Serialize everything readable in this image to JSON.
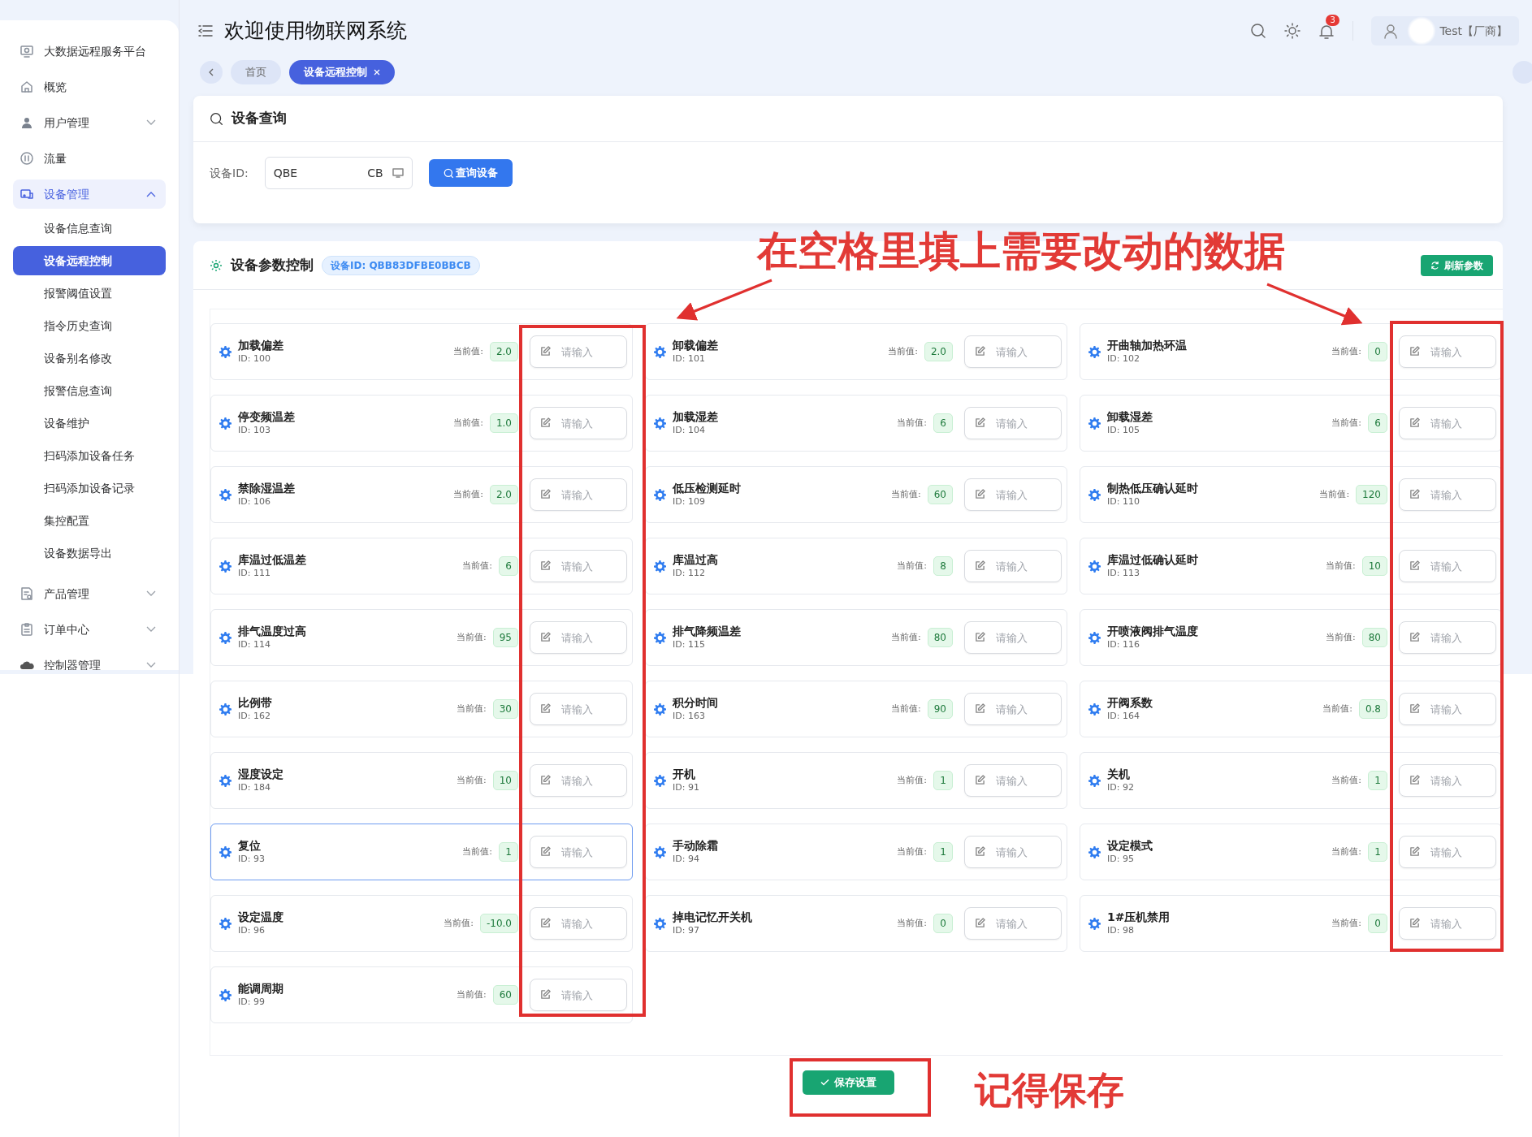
{
  "sidebar": {
    "items": [
      {
        "label": "大数据远程服务平台",
        "selected": false
      },
      {
        "label": "概览",
        "selected": false
      },
      {
        "label": "用户管理",
        "selected": false,
        "expanded": false
      },
      {
        "label": "流量",
        "selected": false
      },
      {
        "label": "设备管理",
        "selected": true,
        "expanded": true,
        "children": [
          {
            "label": "设备信息查询",
            "selected": false
          },
          {
            "label": "设备远程控制",
            "selected": true
          },
          {
            "label": "报警阈值设置",
            "selected": false
          },
          {
            "label": "指令历史查询",
            "selected": false
          },
          {
            "label": "设备别名修改",
            "selected": false
          },
          {
            "label": "报警信息查询",
            "selected": false
          },
          {
            "label": "设备维护",
            "selected": false
          },
          {
            "label": "扫码添加设备任务",
            "selected": false
          },
          {
            "label": "扫码添加设备记录",
            "selected": false
          },
          {
            "label": "集控配置",
            "selected": false
          },
          {
            "label": "设备数据导出",
            "selected": false
          }
        ]
      },
      {
        "label": "产品管理",
        "selected": false,
        "expanded": false
      },
      {
        "label": "订单中心",
        "selected": false,
        "expanded": false
      },
      {
        "label": "控制器管理",
        "selected": false,
        "expanded": false
      }
    ]
  },
  "header": {
    "title": "欢迎使用物联网系统",
    "notification_count": "3",
    "user": "Test【厂商】"
  },
  "tabs": [
    {
      "label": "首页",
      "selected": false,
      "closable": false
    },
    {
      "label": "设备远程控制",
      "selected": true,
      "closable": true
    }
  ],
  "query": {
    "title": "设备查询",
    "field_label": "设备ID:",
    "value_start": "QBE",
    "value_end": "CB",
    "button": "查询设备"
  },
  "params": {
    "title": "设备参数控制",
    "device_badge": "设备ID: QBB83DFBE0BBCB",
    "refresh_button": "刷新参数",
    "save_button": "保存设置",
    "parameters": [
      {
        "name": "加载偏差",
        "id": "ID: 100",
        "label": "当前值:",
        "value": "2.0",
        "placeholder": "请输入",
        "highlighted": false
      },
      {
        "name": "卸载偏差",
        "id": "ID: 101",
        "label": "当前值:",
        "value": "2.0",
        "placeholder": "请输入",
        "highlighted": false
      },
      {
        "name": "开曲轴加热环温",
        "id": "ID: 102",
        "label": "当前值:",
        "value": "0",
        "placeholder": "请输入",
        "highlighted": false
      },
      {
        "name": "停变频温差",
        "id": "ID: 103",
        "label": "当前值:",
        "value": "1.0",
        "placeholder": "请输入",
        "highlighted": false
      },
      {
        "name": "加载湿差",
        "id": "ID: 104",
        "label": "当前值:",
        "value": "6",
        "placeholder": "请输入",
        "highlighted": false
      },
      {
        "name": "卸载湿差",
        "id": "ID: 105",
        "label": "当前值:",
        "value": "6",
        "placeholder": "请输入",
        "highlighted": false
      },
      {
        "name": "禁除湿温差",
        "id": "ID: 106",
        "label": "当前值:",
        "value": "2.0",
        "placeholder": "请输入",
        "highlighted": false
      },
      {
        "name": "低压检测延时",
        "id": "ID: 109",
        "label": "当前值:",
        "value": "60",
        "placeholder": "请输入",
        "highlighted": false
      },
      {
        "name": "制热低压确认延时",
        "id": "ID: 110",
        "label": "当前值:",
        "value": "120",
        "placeholder": "请输入",
        "highlighted": false
      },
      {
        "name": "库温过低温差",
        "id": "ID: 111",
        "label": "当前值:",
        "value": "6",
        "placeholder": "请输入",
        "highlighted": false
      },
      {
        "name": "库温过高",
        "id": "ID: 112",
        "label": "当前值:",
        "value": "8",
        "placeholder": "请输入",
        "highlighted": false
      },
      {
        "name": "库温过低确认延时",
        "id": "ID: 113",
        "label": "当前值:",
        "value": "10",
        "placeholder": "请输入",
        "highlighted": false
      },
      {
        "name": "排气温度过高",
        "id": "ID: 114",
        "label": "当前值:",
        "value": "95",
        "placeholder": "请输入",
        "highlighted": false
      },
      {
        "name": "排气降频温差",
        "id": "ID: 115",
        "label": "当前值:",
        "value": "80",
        "placeholder": "请输入",
        "highlighted": false
      },
      {
        "name": "开喷液阀排气温度",
        "id": "ID: 116",
        "label": "当前值:",
        "value": "80",
        "placeholder": "请输入",
        "highlighted": false
      },
      {
        "name": "比例带",
        "id": "ID: 162",
        "label": "当前值:",
        "value": "30",
        "placeholder": "请输入",
        "highlighted": false
      },
      {
        "name": "积分时间",
        "id": "ID: 163",
        "label": "当前值:",
        "value": "90",
        "placeholder": "请输入",
        "highlighted": false
      },
      {
        "name": "开阀系数",
        "id": "ID: 164",
        "label": "当前值:",
        "value": "0.8",
        "placeholder": "请输入",
        "highlighted": false
      },
      {
        "name": "湿度设定",
        "id": "ID: 184",
        "label": "当前值:",
        "value": "10",
        "placeholder": "请输入",
        "highlighted": false
      },
      {
        "name": "开机",
        "id": "ID: 91",
        "label": "当前值:",
        "value": "1",
        "placeholder": "请输入",
        "highlighted": false
      },
      {
        "name": "关机",
        "id": "ID: 92",
        "label": "当前值:",
        "value": "1",
        "placeholder": "请输入",
        "highlighted": false
      },
      {
        "name": "复位",
        "id": "ID: 93",
        "label": "当前值:",
        "value": "1",
        "placeholder": "请输入",
        "highlighted": true
      },
      {
        "name": "手动除霜",
        "id": "ID: 94",
        "label": "当前值:",
        "value": "1",
        "placeholder": "请输入",
        "highlighted": false
      },
      {
        "name": "设定模式",
        "id": "ID: 95",
        "label": "当前值:",
        "value": "1",
        "placeholder": "请输入",
        "highlighted": false
      },
      {
        "name": "设定温度",
        "id": "ID: 96",
        "label": "当前值:",
        "value": "-10.0",
        "placeholder": "请输入",
        "highlighted": false
      },
      {
        "name": "掉电记忆开关机",
        "id": "ID: 97",
        "label": "当前值:",
        "value": "0",
        "placeholder": "请输入",
        "highlighted": false
      },
      {
        "name": "1#压机禁用",
        "id": "ID: 98",
        "label": "当前值:",
        "value": "0",
        "placeholder": "请输入",
        "highlighted": false
      },
      {
        "name": "能调周期",
        "id": "ID: 99",
        "label": "当前值:",
        "value": "60",
        "placeholder": "请输入",
        "highlighted": false
      }
    ]
  },
  "annotations": {
    "instruction": "在空格里填上需要改动的数据",
    "save_reminder": "记得保存"
  }
}
